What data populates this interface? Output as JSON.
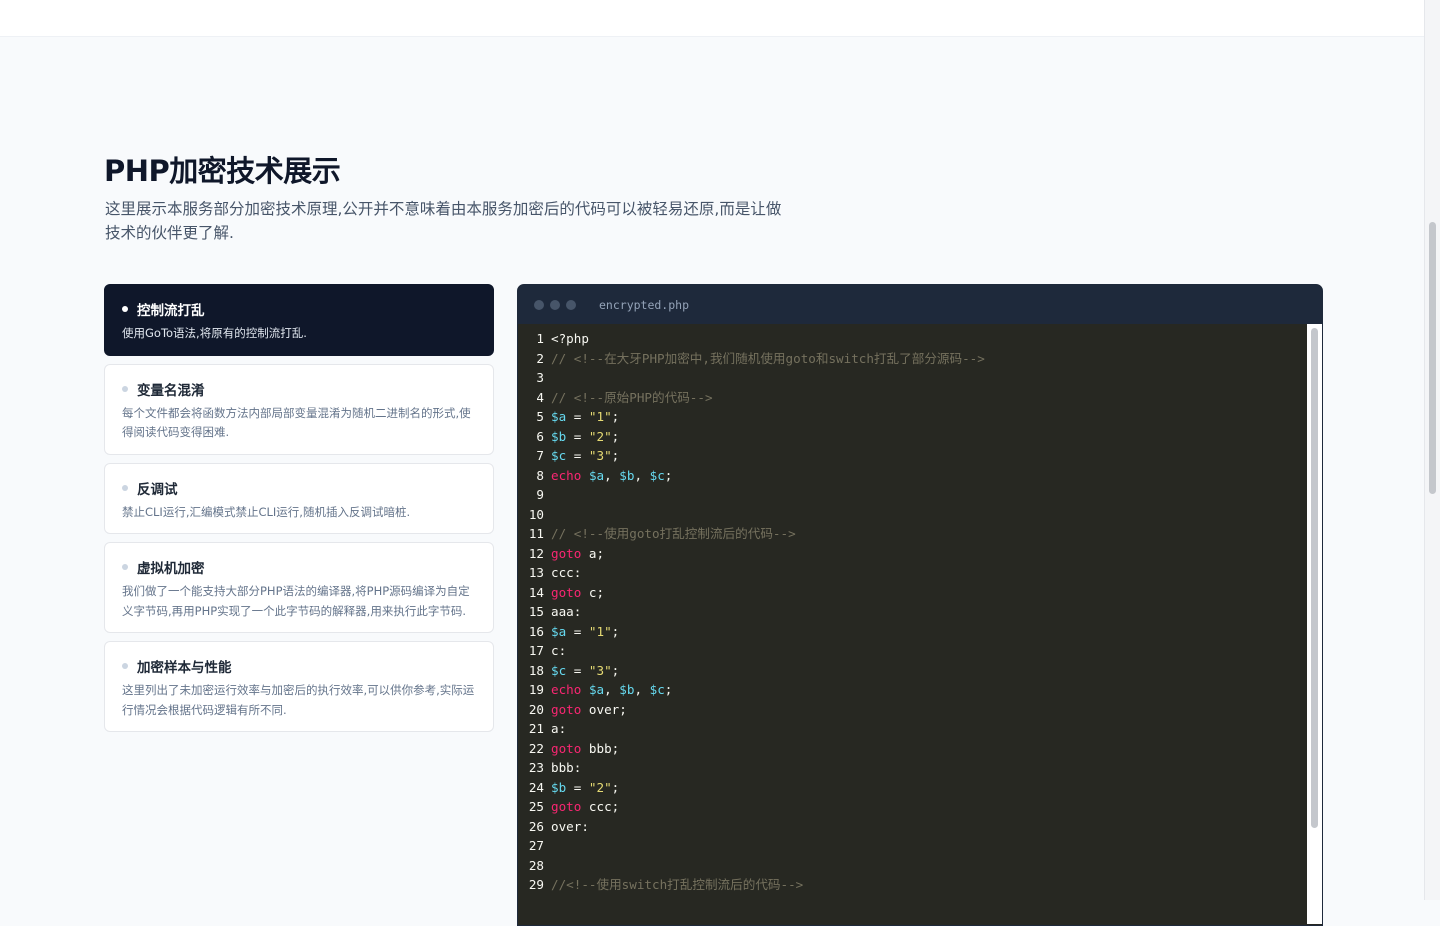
{
  "page": {
    "title": "PHP加密技术展示",
    "subtitle": "这里展示本服务部分加密技术原理,公开并不意味着由本服务加密后的代码可以被轻易还原,而是让做技术的伙伴更了解."
  },
  "features": [
    {
      "title": "控制流打乱",
      "desc": "使用GoTo语法,将原有的控制流打乱.",
      "active": true
    },
    {
      "title": "变量名混淆",
      "desc": "每个文件都会将函数方法内部局部变量混淆为随机二进制名的形式,使得阅读代码变得困难.",
      "active": false
    },
    {
      "title": "反调试",
      "desc": "禁止CLI运行,汇编模式禁止CLI运行,随机插入反调试暗桩.",
      "active": false
    },
    {
      "title": "虚拟机加密",
      "desc": "我们做了一个能支持大部分PHP语法的编译器,将PHP源码编译为自定义字节码,再用PHP实现了一个此字节码的解释器,用来执行此字节码.",
      "active": false
    },
    {
      "title": "加密样本与性能",
      "desc": "这里列出了未加密运行效率与加密后的执行效率,可以供你参考,实际运行情况会根据代码逻辑有所不同.",
      "active": false
    }
  ],
  "code_window": {
    "filename": "encrypted.php",
    "lines": [
      {
        "n": "1",
        "tokens": [
          [
            "plain",
            "<?php"
          ]
        ]
      },
      {
        "n": "2",
        "tokens": [
          [
            "comment",
            "// <!--在大牙PHP加密中,我们随机使用goto和switch打乱了部分源码-->"
          ]
        ]
      },
      {
        "n": "3",
        "tokens": []
      },
      {
        "n": "4",
        "tokens": [
          [
            "comment",
            "// <!--原始PHP的代码-->"
          ]
        ]
      },
      {
        "n": "5",
        "tokens": [
          [
            "var",
            "$a"
          ],
          [
            "plain",
            " = "
          ],
          [
            "string",
            "\"1\""
          ],
          [
            "plain",
            ";"
          ]
        ]
      },
      {
        "n": "6",
        "tokens": [
          [
            "var",
            "$b"
          ],
          [
            "plain",
            " = "
          ],
          [
            "string",
            "\"2\""
          ],
          [
            "plain",
            ";"
          ]
        ]
      },
      {
        "n": "7",
        "tokens": [
          [
            "var",
            "$c"
          ],
          [
            "plain",
            " = "
          ],
          [
            "string",
            "\"3\""
          ],
          [
            "plain",
            ";"
          ]
        ]
      },
      {
        "n": "8",
        "tokens": [
          [
            "keyword",
            "echo"
          ],
          [
            "plain",
            " "
          ],
          [
            "var",
            "$a"
          ],
          [
            "plain",
            ", "
          ],
          [
            "var",
            "$b"
          ],
          [
            "plain",
            ", "
          ],
          [
            "var",
            "$c"
          ],
          [
            "plain",
            ";"
          ]
        ]
      },
      {
        "n": "9",
        "tokens": []
      },
      {
        "n": "10",
        "tokens": []
      },
      {
        "n": "11",
        "tokens": [
          [
            "comment",
            "// <!--使用goto打乱控制流后的代码-->"
          ]
        ]
      },
      {
        "n": "12",
        "tokens": [
          [
            "keyword",
            "goto"
          ],
          [
            "plain",
            " a;"
          ]
        ]
      },
      {
        "n": "13",
        "tokens": [
          [
            "plain",
            "ccc:"
          ]
        ]
      },
      {
        "n": "14",
        "tokens": [
          [
            "keyword",
            "goto"
          ],
          [
            "plain",
            " c;"
          ]
        ]
      },
      {
        "n": "15",
        "tokens": [
          [
            "plain",
            "aaa:"
          ]
        ]
      },
      {
        "n": "16",
        "tokens": [
          [
            "var",
            "$a"
          ],
          [
            "plain",
            " = "
          ],
          [
            "string",
            "\"1\""
          ],
          [
            "plain",
            ";"
          ]
        ]
      },
      {
        "n": "17",
        "tokens": [
          [
            "plain",
            "c:"
          ]
        ]
      },
      {
        "n": "18",
        "tokens": [
          [
            "var",
            "$c"
          ],
          [
            "plain",
            " = "
          ],
          [
            "string",
            "\"3\""
          ],
          [
            "plain",
            ";"
          ]
        ]
      },
      {
        "n": "19",
        "tokens": [
          [
            "keyword",
            "echo"
          ],
          [
            "plain",
            " "
          ],
          [
            "var",
            "$a"
          ],
          [
            "plain",
            ", "
          ],
          [
            "var",
            "$b"
          ],
          [
            "plain",
            ", "
          ],
          [
            "var",
            "$c"
          ],
          [
            "plain",
            ";"
          ]
        ]
      },
      {
        "n": "20",
        "tokens": [
          [
            "keyword",
            "goto"
          ],
          [
            "plain",
            " over;"
          ]
        ]
      },
      {
        "n": "21",
        "tokens": [
          [
            "plain",
            "a:"
          ]
        ]
      },
      {
        "n": "22",
        "tokens": [
          [
            "keyword",
            "goto"
          ],
          [
            "plain",
            " bbb;"
          ]
        ]
      },
      {
        "n": "23",
        "tokens": [
          [
            "plain",
            "bbb:"
          ]
        ]
      },
      {
        "n": "24",
        "tokens": [
          [
            "var",
            "$b"
          ],
          [
            "plain",
            " = "
          ],
          [
            "string",
            "\"2\""
          ],
          [
            "plain",
            ";"
          ]
        ]
      },
      {
        "n": "25",
        "tokens": [
          [
            "keyword",
            "goto"
          ],
          [
            "plain",
            " ccc;"
          ]
        ]
      },
      {
        "n": "26",
        "tokens": [
          [
            "plain",
            "over:"
          ]
        ]
      },
      {
        "n": "27",
        "tokens": []
      },
      {
        "n": "28",
        "tokens": []
      },
      {
        "n": "29",
        "tokens": [
          [
            "comment",
            "//<!--使用switch打乱控制流后的代码-->"
          ]
        ]
      }
    ]
  },
  "colors": {
    "active_card_bg": "#0f172a",
    "code_bg": "#272822",
    "code_titlebar_bg": "#1e293b",
    "comment": "#75715e",
    "keyword": "#f92672",
    "variable": "#66d9ef",
    "string": "#e6db74"
  }
}
